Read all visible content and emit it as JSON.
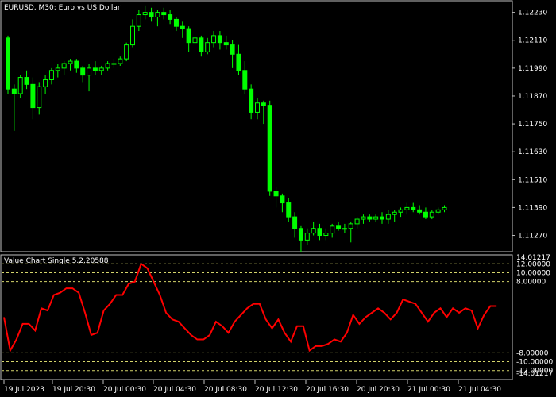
{
  "main_chart": {
    "title": "EURUSD, M30:  Euro vs US Dollar",
    "y_labels": [
      "1.12230",
      "1.12110",
      "1.11990",
      "1.11870",
      "1.11750",
      "1.11630",
      "1.11510",
      "1.11390",
      "1.11270"
    ],
    "ylim": [
      1.112,
      1.1228
    ],
    "colors": {
      "bull_body": "#000000",
      "bull_outline": "#00ff00",
      "bear_body": "#00ff00",
      "wick": "#00ff00",
      "frame": "#c0c0c0",
      "bg": "#000000"
    }
  },
  "indicator": {
    "title": "Value Chart Single 5.2.20588",
    "top_label": "14.01217",
    "levels": [
      {
        "value": 12,
        "label": "12.00000"
      },
      {
        "value": 10,
        "label": "10.00000"
      },
      {
        "value": 8,
        "label": "8.00000"
      },
      {
        "value": -8,
        "label": "-8.00000"
      },
      {
        "value": -10,
        "label": "-10.00000"
      },
      {
        "value": -12,
        "label": "-12.00000"
      }
    ],
    "bottom_label": "-14.01217",
    "line_color": "#ff0000",
    "level_color": "#d4d46a"
  },
  "x_labels": [
    "19 Jul 2023",
    "19 Jul 20:30",
    "20 Jul 00:30",
    "20 Jul 04:30",
    "20 Jul 08:30",
    "20 Jul 12:30",
    "20 Jul 16:30",
    "20 Jul 20:30",
    "21 Jul 00:30",
    "21 Jul 04:30"
  ],
  "chart_data": {
    "type": "candlestick",
    "candles": [
      [
        1.1212,
        1.1213,
        1.1188,
        1.119
      ],
      [
        1.119,
        1.1192,
        1.1172,
        1.1188
      ],
      [
        1.1188,
        1.1196,
        1.1186,
        1.1195
      ],
      [
        1.1195,
        1.1198,
        1.119,
        1.1192
      ],
      [
        1.1192,
        1.1195,
        1.1177,
        1.1182
      ],
      [
        1.1182,
        1.1193,
        1.1179,
        1.1191
      ],
      [
        1.1191,
        1.1196,
        1.1188,
        1.1194
      ],
      [
        1.1194,
        1.1199,
        1.1192,
        1.1198
      ],
      [
        1.1198,
        1.1201,
        1.1195,
        1.1199
      ],
      [
        1.1199,
        1.1202,
        1.1196,
        1.1201
      ],
      [
        1.1201,
        1.1203,
        1.1198,
        1.1202
      ],
      [
        1.1202,
        1.1203,
        1.1197,
        1.1199
      ],
      [
        1.1199,
        1.12,
        1.1193,
        1.1196
      ],
      [
        1.1196,
        1.1201,
        1.1189,
        1.1199
      ],
      [
        1.1199,
        1.1202,
        1.1196,
        1.1198
      ],
      [
        1.1198,
        1.12,
        1.1196,
        1.1199
      ],
      [
        1.1199,
        1.1202,
        1.1198,
        1.1201
      ],
      [
        1.1201,
        1.1203,
        1.1199,
        1.1201
      ],
      [
        1.1201,
        1.1204,
        1.12,
        1.1203
      ],
      [
        1.1203,
        1.121,
        1.1202,
        1.1209
      ],
      [
        1.1209,
        1.122,
        1.1208,
        1.1217
      ],
      [
        1.1217,
        1.1224,
        1.1215,
        1.1222
      ],
      [
        1.1222,
        1.1226,
        1.122,
        1.1223
      ],
      [
        1.1223,
        1.1225,
        1.1219,
        1.1221
      ],
      [
        1.1221,
        1.1224,
        1.1217,
        1.1223
      ],
      [
        1.1223,
        1.1225,
        1.122,
        1.1222
      ],
      [
        1.1222,
        1.1224,
        1.1218,
        1.122
      ],
      [
        1.122,
        1.1221,
        1.1215,
        1.1217
      ],
      [
        1.1217,
        1.1219,
        1.1212,
        1.1216
      ],
      [
        1.1216,
        1.1217,
        1.1206,
        1.121
      ],
      [
        1.121,
        1.1214,
        1.1208,
        1.1212
      ],
      [
        1.1212,
        1.1213,
        1.1204,
        1.1206
      ],
      [
        1.1206,
        1.1212,
        1.1205,
        1.121
      ],
      [
        1.121,
        1.1215,
        1.1208,
        1.1213
      ],
      [
        1.1213,
        1.1215,
        1.1207,
        1.121
      ],
      [
        1.121,
        1.1213,
        1.1207,
        1.1209
      ],
      [
        1.1209,
        1.1211,
        1.1199,
        1.1205
      ],
      [
        1.1205,
        1.1209,
        1.1196,
        1.1198
      ],
      [
        1.1198,
        1.1202,
        1.1188,
        1.119
      ],
      [
        1.119,
        1.1192,
        1.1177,
        1.118
      ],
      [
        1.118,
        1.1186,
        1.1177,
        1.1184
      ],
      [
        1.1184,
        1.1185,
        1.1175,
        1.1183
      ],
      [
        1.1183,
        1.1185,
        1.1144,
        1.1146
      ],
      [
        1.1146,
        1.1148,
        1.1139,
        1.1144
      ],
      [
        1.1144,
        1.1145,
        1.1137,
        1.1141
      ],
      [
        1.1141,
        1.1143,
        1.1133,
        1.1135
      ],
      [
        1.1135,
        1.1137,
        1.1126,
        1.113
      ],
      [
        1.113,
        1.1131,
        1.112,
        1.1125
      ],
      [
        1.1125,
        1.113,
        1.1123,
        1.1128
      ],
      [
        1.1128,
        1.1133,
        1.1127,
        1.113
      ],
      [
        1.113,
        1.1132,
        1.1125,
        1.1127
      ],
      [
        1.1127,
        1.113,
        1.1125,
        1.1128
      ],
      [
        1.1128,
        1.1132,
        1.1126,
        1.1131
      ],
      [
        1.1131,
        1.1133,
        1.1129,
        1.113
      ],
      [
        1.113,
        1.1132,
        1.1128,
        1.113
      ],
      [
        1.113,
        1.1133,
        1.1124,
        1.1132
      ],
      [
        1.1132,
        1.1135,
        1.113,
        1.1134
      ],
      [
        1.1134,
        1.1136,
        1.1132,
        1.1135
      ],
      [
        1.1135,
        1.1136,
        1.1133,
        1.1134
      ],
      [
        1.1134,
        1.1136,
        1.1133,
        1.1135
      ],
      [
        1.1135,
        1.1137,
        1.1132,
        1.1134
      ],
      [
        1.1134,
        1.1138,
        1.1132,
        1.1136
      ],
      [
        1.1136,
        1.1138,
        1.1133,
        1.1137
      ],
      [
        1.1137,
        1.1139,
        1.1135,
        1.1138
      ],
      [
        1.1138,
        1.1141,
        1.1136,
        1.1139
      ],
      [
        1.1139,
        1.1141,
        1.1137,
        1.1138
      ],
      [
        1.1138,
        1.114,
        1.1136,
        1.1137
      ],
      [
        1.1137,
        1.1139,
        1.1134,
        1.1135
      ],
      [
        1.1135,
        1.1138,
        1.1134,
        1.1137
      ],
      [
        1.1137,
        1.1139,
        1.1136,
        1.1138
      ],
      [
        1.1138,
        1.114,
        1.1137,
        1.1139
      ]
    ],
    "indicator_values": [
      0,
      -7.5,
      -5,
      -1.5,
      -1.5,
      -3,
      2,
      1.5,
      5,
      5.5,
      6.5,
      6.5,
      5.5,
      1,
      -4,
      -3.5,
      1.5,
      3,
      5,
      5,
      7.5,
      8,
      12,
      11,
      8,
      5,
      1,
      -0.5,
      -1,
      -2.5,
      -4,
      -5,
      -5,
      -4,
      -1,
      -2,
      -3.5,
      -1,
      0.5,
      2,
      3,
      3,
      -0.5,
      -2.5,
      -0.5,
      -3.5,
      -5.5,
      -2,
      -2,
      -7.5,
      -6.5,
      -6.5,
      -6,
      -5,
      -5.5,
      -3.5,
      0.5,
      -1.5,
      0,
      1,
      2,
      1,
      -0.5,
      1,
      4,
      3.5,
      3,
      1,
      -1,
      1,
      2,
      0,
      2,
      1,
      2,
      1.5,
      -2.5,
      0.5,
      2.5,
      2.5
    ]
  }
}
